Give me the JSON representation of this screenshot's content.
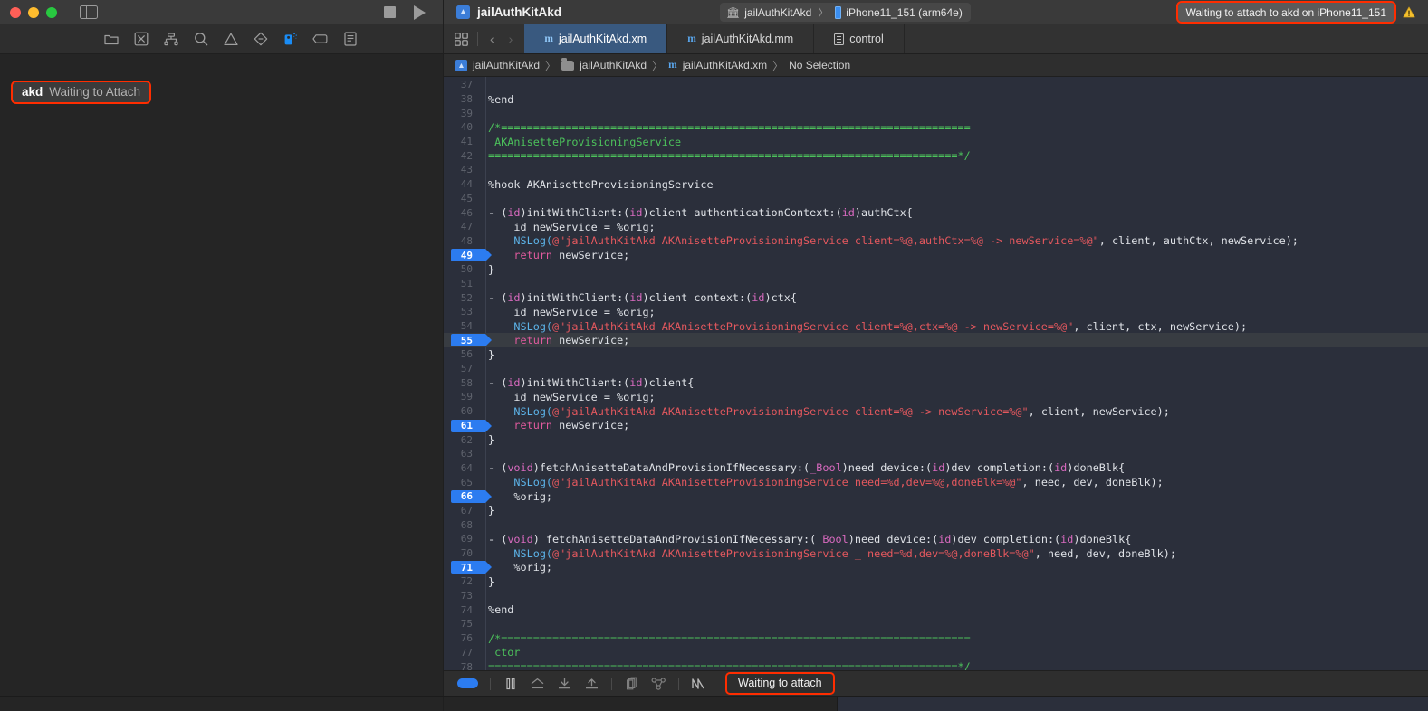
{
  "window": {
    "traffic_lights": [
      "close",
      "minimize",
      "zoom"
    ],
    "project_title": "jailAuthKitAkd",
    "scheme": {
      "name": "jailAuthKitAkd",
      "separator": "〉",
      "destination": "iPhone11_151 (arm64e)"
    },
    "status_message": "Waiting to attach to akd on iPhone11_151",
    "warning_count_icon": "warning-triangle-icon"
  },
  "navigator": {
    "icons": [
      {
        "name": "folder-icon",
        "label": "Project navigator"
      },
      {
        "name": "source-control-icon",
        "label": "Source control navigator"
      },
      {
        "name": "hierarchy-icon",
        "label": "Symbol navigator"
      },
      {
        "name": "search-icon",
        "label": "Find navigator"
      },
      {
        "name": "warning-triangle-icon",
        "label": "Issue navigator"
      },
      {
        "name": "diamond-icon",
        "label": "Test navigator"
      },
      {
        "name": "debug-gauge-icon",
        "label": "Debug navigator"
      },
      {
        "name": "breakpoint-tag-icon",
        "label": "Breakpoint navigator"
      },
      {
        "name": "report-list-icon",
        "label": "Report navigator"
      }
    ],
    "active_icon_index": 6,
    "process": {
      "name": "akd",
      "state": "Waiting to Attach"
    }
  },
  "editor": {
    "toolbar_icons": [
      {
        "name": "grid-layout-icon"
      },
      {
        "name": "back-chevron-icon"
      },
      {
        "name": "forward-chevron-icon"
      }
    ],
    "tabs": [
      {
        "label": "jailAuthKitAkd.xm",
        "icon": "objc-file-icon",
        "active": true
      },
      {
        "label": "jailAuthKitAkd.mm",
        "icon": "objc-file-icon",
        "active": false
      },
      {
        "label": "control",
        "icon": "plain-file-icon",
        "active": false
      }
    ],
    "breadcrumb": [
      {
        "label": "jailAuthKitAkd",
        "icon": "project-icon"
      },
      {
        "label": "jailAuthKitAkd",
        "icon": "folder-icon"
      },
      {
        "label": "jailAuthKitAkd.xm",
        "icon": "objc-file-icon"
      },
      {
        "label": "No Selection",
        "icon": "none"
      }
    ],
    "breadcrumb_separator": "〉",
    "first_visible_line": 37,
    "breakpoint_lines": [
      49,
      55,
      61,
      66,
      71
    ],
    "highlighted_line": 55,
    "lines": [
      {
        "n": 37,
        "tokens": []
      },
      {
        "n": 38,
        "tokens": [
          {
            "t": "pln",
            "s": "%end"
          }
        ]
      },
      {
        "n": 39,
        "tokens": []
      },
      {
        "n": 40,
        "tokens": [
          {
            "t": "com",
            "s": "/*========================================================================="
          }
        ]
      },
      {
        "n": 41,
        "tokens": [
          {
            "t": "com",
            "s": " AKAnisetteProvisioningService"
          }
        ]
      },
      {
        "n": 42,
        "tokens": [
          {
            "t": "com",
            "s": "=========================================================================*/"
          }
        ]
      },
      {
        "n": 43,
        "tokens": []
      },
      {
        "n": 44,
        "tokens": [
          {
            "t": "pln",
            "s": "%hook AKAnisetteProvisioningService"
          }
        ]
      },
      {
        "n": 45,
        "tokens": []
      },
      {
        "n": 46,
        "tokens": [
          {
            "t": "pln",
            "s": "- ("
          },
          {
            "t": "type",
            "s": "id"
          },
          {
            "t": "pln",
            "s": ")initWithClient:("
          },
          {
            "t": "type",
            "s": "id"
          },
          {
            "t": "pln",
            "s": ")client authenticationContext:("
          },
          {
            "t": "type",
            "s": "id"
          },
          {
            "t": "pln",
            "s": ")authCtx{"
          }
        ]
      },
      {
        "n": 47,
        "tokens": [
          {
            "t": "pln",
            "s": "    id newService = %orig;"
          }
        ]
      },
      {
        "n": 48,
        "tokens": [
          {
            "t": "fn",
            "s": "    NSLog("
          },
          {
            "t": "str",
            "s": "@\"jailAuthKitAkd AKAnisetteProvisioningService client=%@,authCtx=%@ -> newService=%@\""
          },
          {
            "t": "pln",
            "s": ", client, authCtx, newService);"
          }
        ]
      },
      {
        "n": 49,
        "tokens": [
          {
            "t": "pln",
            "s": "    "
          },
          {
            "t": "key",
            "s": "return"
          },
          {
            "t": "pln",
            "s": " newService;"
          }
        ]
      },
      {
        "n": 50,
        "tokens": [
          {
            "t": "pln",
            "s": "}"
          }
        ]
      },
      {
        "n": 51,
        "tokens": []
      },
      {
        "n": 52,
        "tokens": [
          {
            "t": "pln",
            "s": "- ("
          },
          {
            "t": "type",
            "s": "id"
          },
          {
            "t": "pln",
            "s": ")initWithClient:("
          },
          {
            "t": "type",
            "s": "id"
          },
          {
            "t": "pln",
            "s": ")client context:("
          },
          {
            "t": "type",
            "s": "id"
          },
          {
            "t": "pln",
            "s": ")ctx{"
          }
        ]
      },
      {
        "n": 53,
        "tokens": [
          {
            "t": "pln",
            "s": "    id newService = %orig;"
          }
        ]
      },
      {
        "n": 54,
        "tokens": [
          {
            "t": "fn",
            "s": "    NSLog("
          },
          {
            "t": "str",
            "s": "@\"jailAuthKitAkd AKAnisetteProvisioningService client=%@,ctx=%@ -> newService=%@\""
          },
          {
            "t": "pln",
            "s": ", client, ctx, newService);"
          }
        ]
      },
      {
        "n": 55,
        "tokens": [
          {
            "t": "pln",
            "s": "    "
          },
          {
            "t": "key",
            "s": "return"
          },
          {
            "t": "pln",
            "s": " newService;"
          }
        ]
      },
      {
        "n": 56,
        "tokens": [
          {
            "t": "pln",
            "s": "}"
          }
        ]
      },
      {
        "n": 57,
        "tokens": []
      },
      {
        "n": 58,
        "tokens": [
          {
            "t": "pln",
            "s": "- ("
          },
          {
            "t": "type",
            "s": "id"
          },
          {
            "t": "pln",
            "s": ")initWithClient:("
          },
          {
            "t": "type",
            "s": "id"
          },
          {
            "t": "pln",
            "s": ")client{"
          }
        ]
      },
      {
        "n": 59,
        "tokens": [
          {
            "t": "pln",
            "s": "    id newService = %orig;"
          }
        ]
      },
      {
        "n": 60,
        "tokens": [
          {
            "t": "fn",
            "s": "    NSLog("
          },
          {
            "t": "str",
            "s": "@\"jailAuthKitAkd AKAnisetteProvisioningService client=%@ -> newService=%@\""
          },
          {
            "t": "pln",
            "s": ", client, newService);"
          }
        ]
      },
      {
        "n": 61,
        "tokens": [
          {
            "t": "pln",
            "s": "    "
          },
          {
            "t": "key",
            "s": "return"
          },
          {
            "t": "pln",
            "s": " newService;"
          }
        ]
      },
      {
        "n": 62,
        "tokens": [
          {
            "t": "pln",
            "s": "}"
          }
        ]
      },
      {
        "n": 63,
        "tokens": []
      },
      {
        "n": 64,
        "tokens": [
          {
            "t": "pln",
            "s": "- ("
          },
          {
            "t": "type",
            "s": "void"
          },
          {
            "t": "pln",
            "s": ")fetchAnisetteDataAndProvisionIfNecessary:("
          },
          {
            "t": "type",
            "s": "_Bool"
          },
          {
            "t": "pln",
            "s": ")need device:("
          },
          {
            "t": "type",
            "s": "id"
          },
          {
            "t": "pln",
            "s": ")dev completion:("
          },
          {
            "t": "type",
            "s": "id"
          },
          {
            "t": "pln",
            "s": ")doneBlk{"
          }
        ]
      },
      {
        "n": 65,
        "tokens": [
          {
            "t": "fn",
            "s": "    NSLog("
          },
          {
            "t": "str",
            "s": "@\"jailAuthKitAkd AKAnisetteProvisioningService need=%d,dev=%@,doneBlk=%@\""
          },
          {
            "t": "pln",
            "s": ", need, dev, doneBlk);"
          }
        ]
      },
      {
        "n": 66,
        "tokens": [
          {
            "t": "pln",
            "s": "    %orig;"
          }
        ]
      },
      {
        "n": 67,
        "tokens": [
          {
            "t": "pln",
            "s": "}"
          }
        ]
      },
      {
        "n": 68,
        "tokens": []
      },
      {
        "n": 69,
        "tokens": [
          {
            "t": "pln",
            "s": "- ("
          },
          {
            "t": "type",
            "s": "void"
          },
          {
            "t": "pln",
            "s": ")_fetchAnisetteDataAndProvisionIfNecessary:("
          },
          {
            "t": "type",
            "s": "_Bool"
          },
          {
            "t": "pln",
            "s": ")need device:("
          },
          {
            "t": "type",
            "s": "id"
          },
          {
            "t": "pln",
            "s": ")dev completion:("
          },
          {
            "t": "type",
            "s": "id"
          },
          {
            "t": "pln",
            "s": ")doneBlk{"
          }
        ]
      },
      {
        "n": 70,
        "tokens": [
          {
            "t": "fn",
            "s": "    NSLog("
          },
          {
            "t": "str",
            "s": "@\"jailAuthKitAkd AKAnisetteProvisioningService _ need=%d,dev=%@,doneBlk=%@\""
          },
          {
            "t": "pln",
            "s": ", need, dev, doneBlk);"
          }
        ]
      },
      {
        "n": 71,
        "tokens": [
          {
            "t": "pln",
            "s": "    %orig;"
          }
        ]
      },
      {
        "n": 72,
        "tokens": [
          {
            "t": "pln",
            "s": "}"
          }
        ]
      },
      {
        "n": 73,
        "tokens": []
      },
      {
        "n": 74,
        "tokens": [
          {
            "t": "pln",
            "s": "%end"
          }
        ]
      },
      {
        "n": 75,
        "tokens": []
      },
      {
        "n": 76,
        "tokens": [
          {
            "t": "com",
            "s": "/*========================================================================="
          }
        ]
      },
      {
        "n": 77,
        "tokens": [
          {
            "t": "com",
            "s": " ctor"
          }
        ]
      },
      {
        "n": 78,
        "tokens": [
          {
            "t": "com",
            "s": "=========================================================================*/"
          }
        ]
      }
    ]
  },
  "debug_bar": {
    "icons": [
      {
        "name": "hide-debug-area-icon"
      },
      {
        "name": "pause-icon"
      },
      {
        "name": "step-over-icon"
      },
      {
        "name": "step-into-icon"
      },
      {
        "name": "step-out-icon"
      },
      {
        "name": "debug-view-hierarchy-icon"
      },
      {
        "name": "debug-memory-graph-icon"
      },
      {
        "name": "simulate-location-icon"
      }
    ],
    "status": "Waiting to attach"
  },
  "colors": {
    "accent_blue": "#2c7cf0",
    "highlight_outline_red": "#ff2d00",
    "comment_green": "#4cc15b",
    "string_red": "#e4585e",
    "keyword_pink": "#e05a9e",
    "type_magenta": "#d86abf",
    "function_blue": "#5cb3e8",
    "editor_bg": "#2b2f3b",
    "chrome_bg": "#252525"
  }
}
